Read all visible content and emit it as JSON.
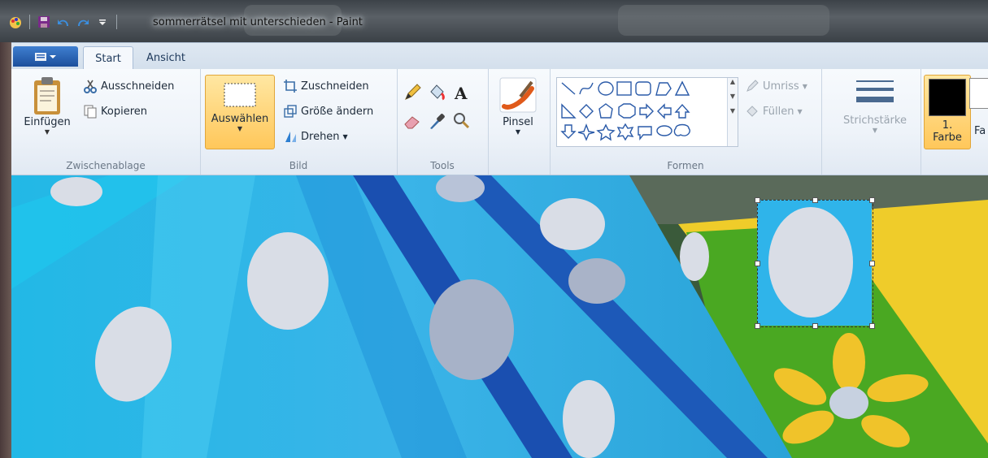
{
  "window": {
    "title": "sommerrätsel mit unterschieden - Paint"
  },
  "tabs": [
    {
      "label": "Start",
      "active": true
    },
    {
      "label": "Ansicht",
      "active": false
    }
  ],
  "ribbon": {
    "clipboard": {
      "paste": "Einfügen",
      "cut": "Ausschneiden",
      "copy": "Kopieren",
      "group": "Zwischenablage"
    },
    "image": {
      "select": "Auswählen",
      "crop": "Zuschneiden",
      "resize": "Größe ändern",
      "rotate": "Drehen",
      "group": "Bild"
    },
    "tools": {
      "group": "Tools"
    },
    "brushes": {
      "label": "Pinsel"
    },
    "shapes": {
      "outline": "Umriss",
      "fill": "Füllen",
      "group": "Formen"
    },
    "size": {
      "label": "Strichstärke"
    },
    "colors": {
      "color1_line1": "1.",
      "color1_line2": "Farbe",
      "color2_partial": "Fa",
      "color1_value": "#000000"
    }
  },
  "colors": {
    "accent": "#ffd36b",
    "tab_blue": "#2a62b5"
  }
}
